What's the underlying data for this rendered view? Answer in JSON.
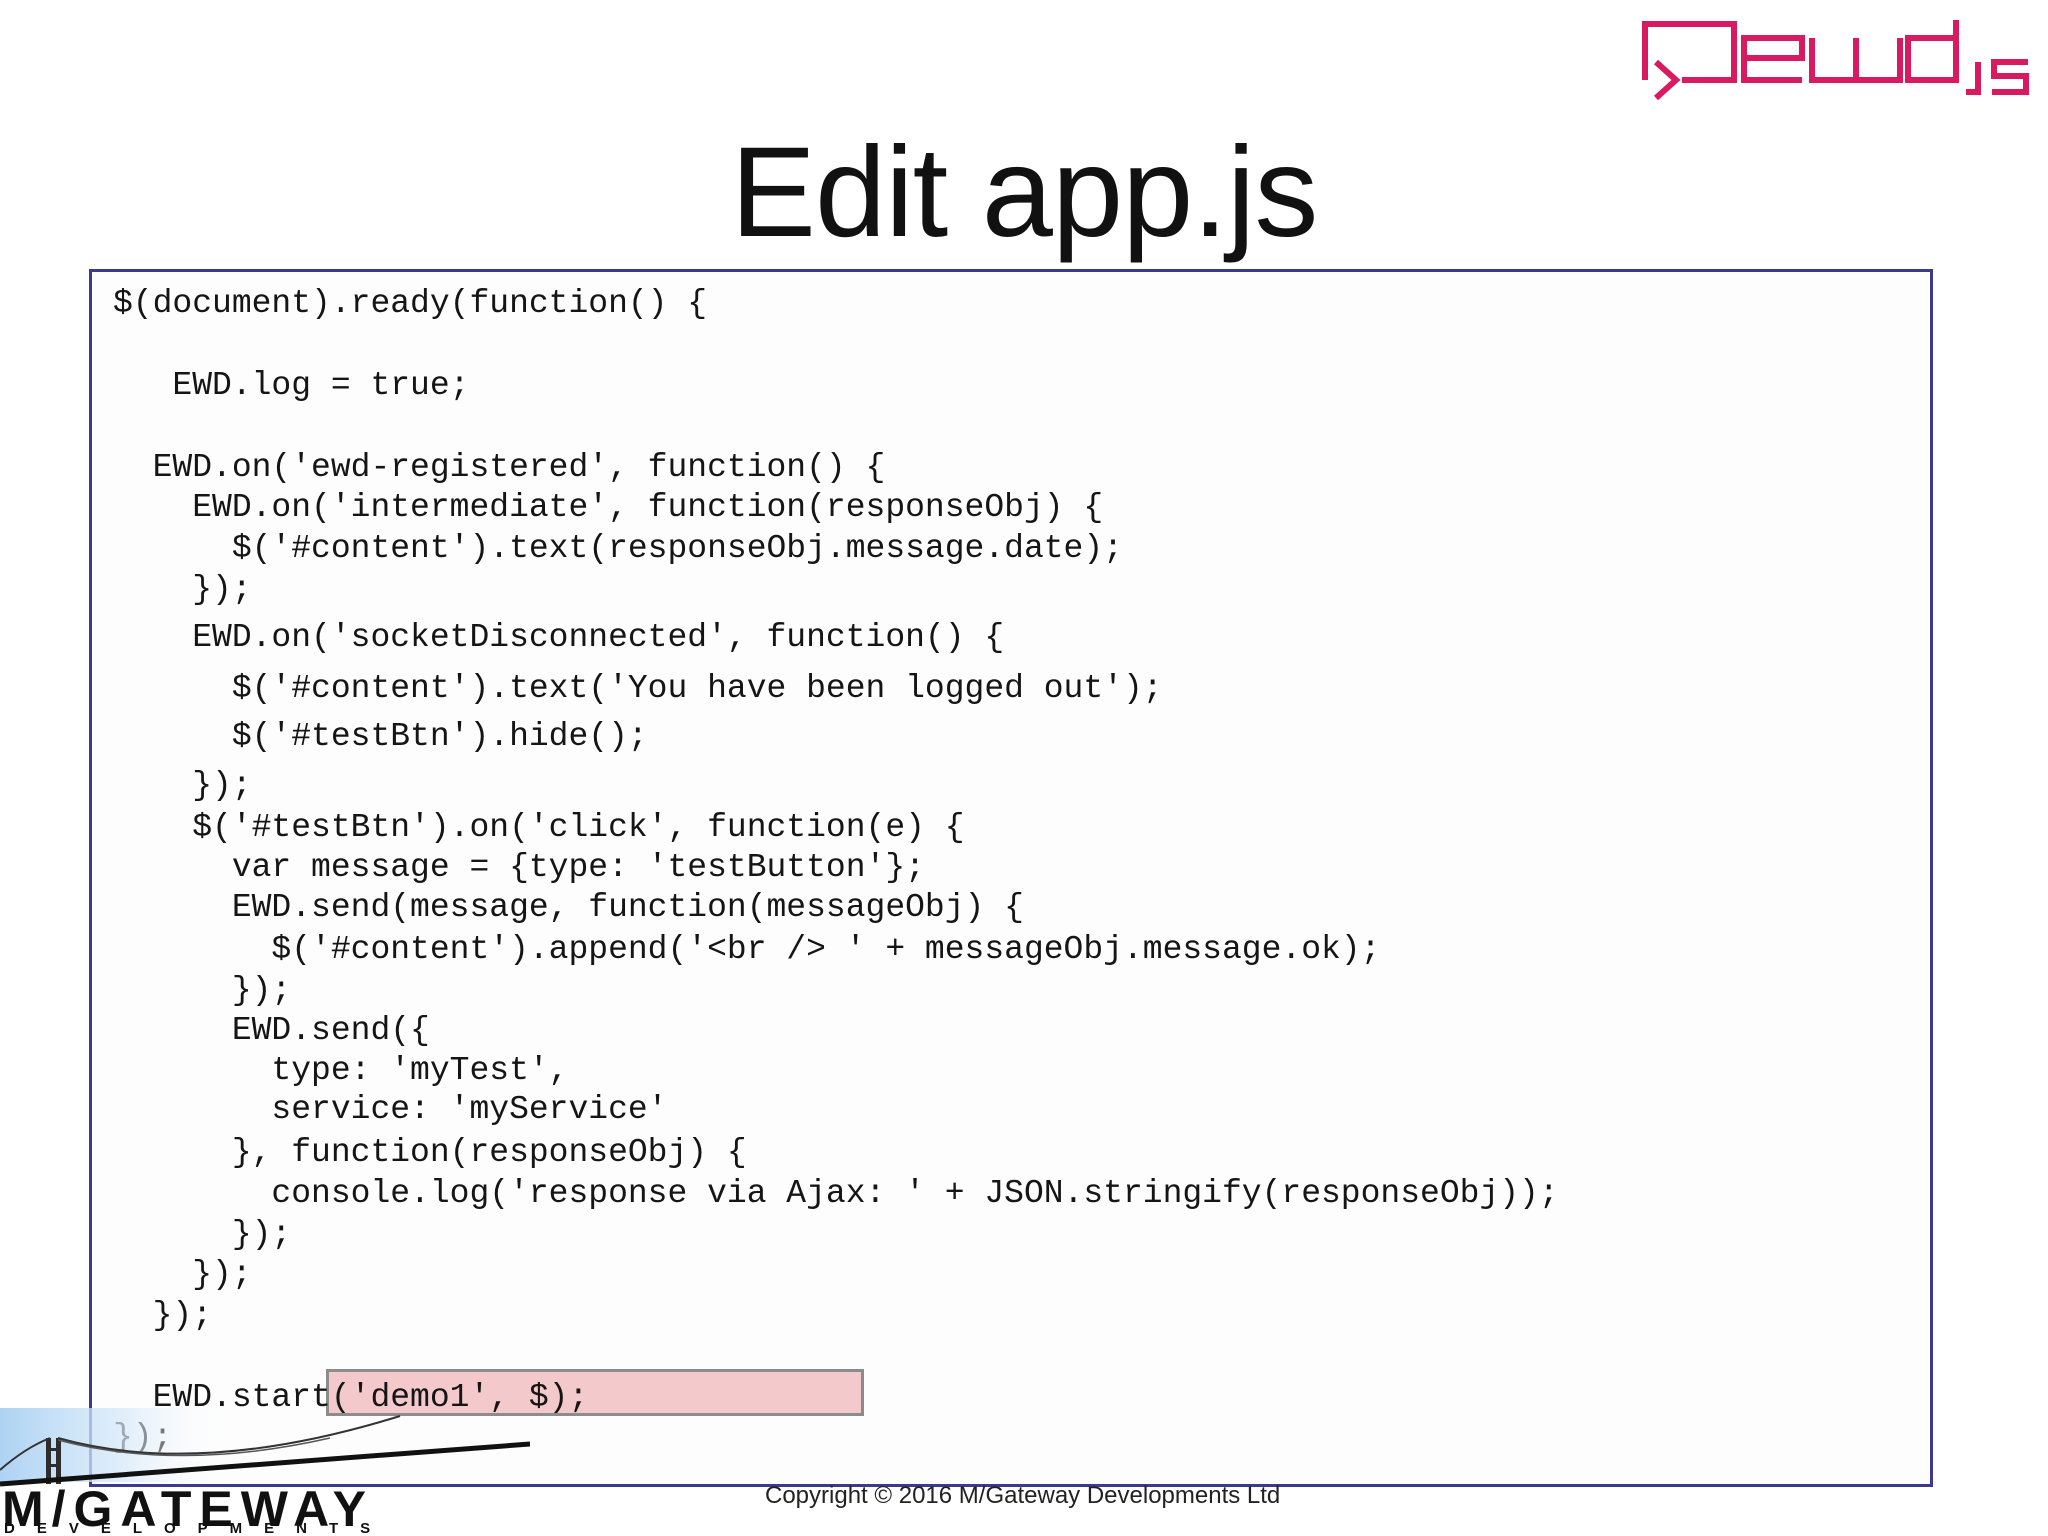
{
  "slide": {
    "title": "Edit app.js",
    "copyright": "Copyright © 2016 M/Gateway Developments Ltd"
  },
  "logos": {
    "ewd_icon": "qewd-js-logo",
    "company_name": "M/GATEWAY",
    "company_sub": "DEVELOPMENTS",
    "company_icon": "golden-gate-bridge-icon"
  },
  "colors": {
    "ewd_logo": "#d81b60",
    "code_border": "#3c3a8e",
    "highlight_fill": "#f3c9cc",
    "bridge_sky": "#bcdcf7"
  },
  "code": {
    "lines": [
      "$(document).ready(function() {",
      "",
      "   EWD.log = true;",
      "",
      "  EWD.on('ewd-registered', function() {",
      "    EWD.on('intermediate', function(responseObj) {",
      "      $('#content').text(responseObj.message.date);",
      "    });",
      "    EWD.on('socketDisconnected', function() {",
      "      $('#content').text('You have been logged out');",
      "      $('#testBtn').hide();",
      "    });",
      "    $('#testBtn').on('click', function(e) {",
      "      var message = {type: 'testButton'};",
      "      EWD.send(message, function(messageObj) {",
      "        $('#content').append('<br /> ' + messageObj.message.ok);",
      "      });",
      "      EWD.send({",
      "        type: 'myTest',",
      "        service: 'myService'",
      "      }, function(responseObj) {",
      "        console.log('response via Ajax: ' + JSON.stringify(responseObj));",
      "      });",
      "    });",
      "  });",
      "",
      "  EWD.start('demo1', $);",
      "});"
    ],
    "highlighted_line": "        service: 'myService'"
  }
}
